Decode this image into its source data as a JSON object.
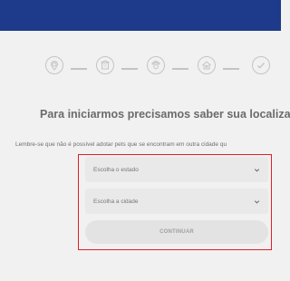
{
  "colors": {
    "header": "#1e3a8a",
    "background": "#f1f1f1",
    "highlight_border": "#e0202a",
    "step_inactive": "#c4c4c4"
  },
  "stepper": {
    "steps": [
      {
        "icon": "map-pin-icon"
      },
      {
        "icon": "building-icon"
      },
      {
        "icon": "pets-icon"
      },
      {
        "icon": "home-heart-icon"
      },
      {
        "icon": "checkmark-icon"
      }
    ]
  },
  "main": {
    "heading": "Para iniciarmos precisamos saber sua localizaç",
    "notice": "Lembre-se que não é possível adotar pets que se encontram em outra cidade qu"
  },
  "form": {
    "state_select": {
      "selected": "Escolha o estado"
    },
    "city_select": {
      "selected": "Escolha a cidade"
    },
    "continue_label": "CONTINUAR"
  }
}
